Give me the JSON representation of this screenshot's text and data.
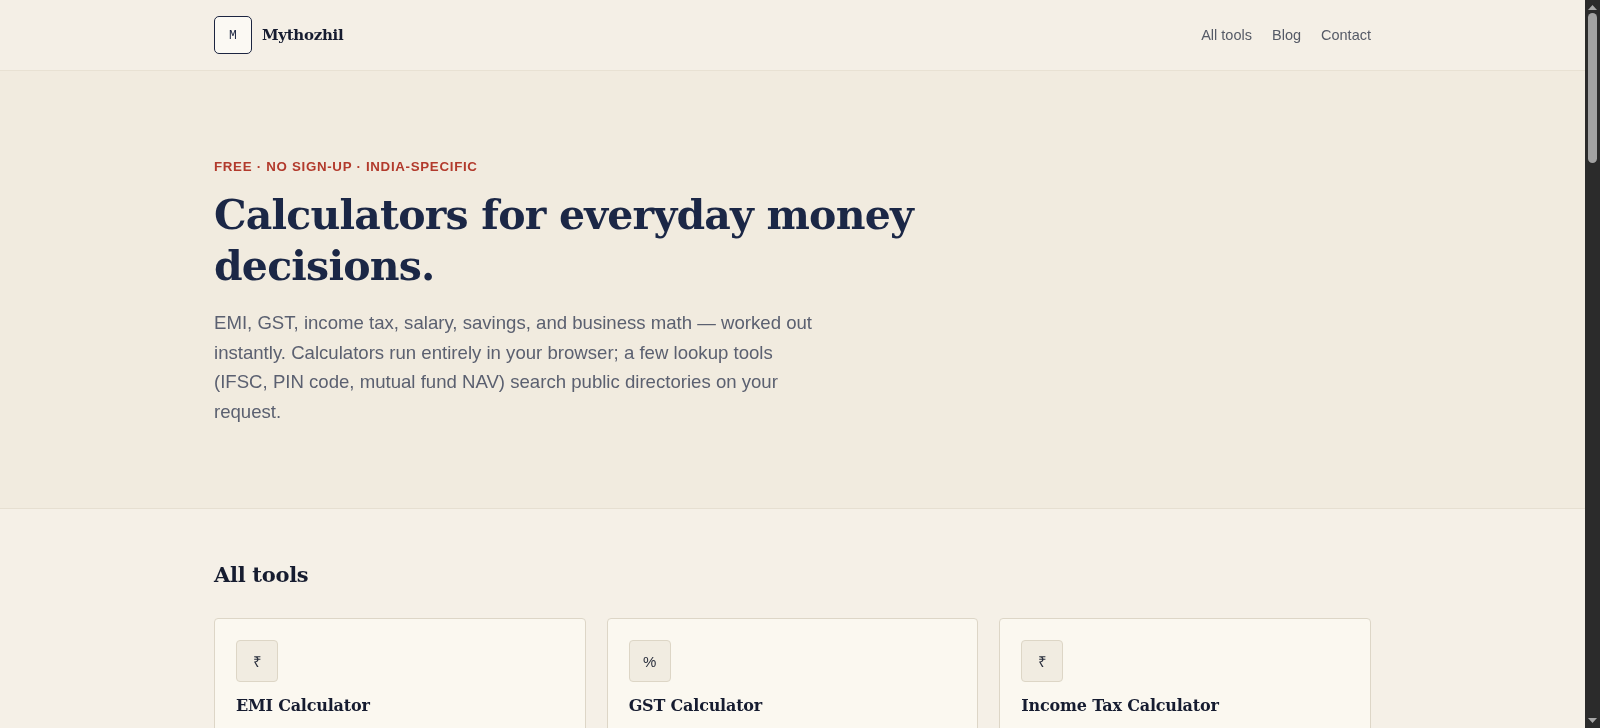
{
  "header": {
    "logo_letter": "M",
    "brand": "Mythozhil",
    "nav": [
      "All tools",
      "Blog",
      "Contact"
    ]
  },
  "hero": {
    "eyebrow": "FREE · NO SIGN-UP · INDIA-SPECIFIC",
    "title": "Calculators for everyday money decisions.",
    "description": "EMI, GST, income tax, salary, savings, and business math — worked out instantly. Calculators run entirely in your browser; a few lookup tools (IFSC, PIN code, mutual fund NAV) search public directories on your request."
  },
  "tools_section": {
    "heading": "All tools",
    "tools": [
      {
        "symbol": "₹",
        "name": "EMI Calculator"
      },
      {
        "symbol": "%",
        "name": "GST Calculator"
      },
      {
        "symbol": "₹",
        "name": "Income Tax Calculator"
      }
    ]
  }
}
